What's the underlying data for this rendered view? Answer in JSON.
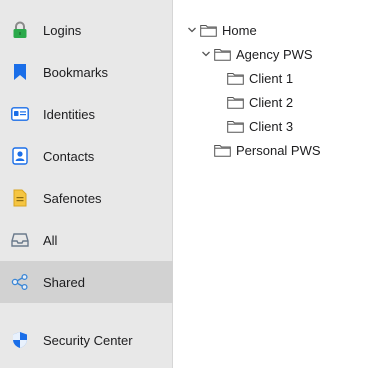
{
  "sidebar": {
    "items": [
      {
        "label": "Logins",
        "icon": "lock-icon",
        "color": "#2aa94a"
      },
      {
        "label": "Bookmarks",
        "icon": "bookmark-icon",
        "color": "#1a6ee8"
      },
      {
        "label": "Identities",
        "icon": "id-card-icon",
        "color": "#1a6ee8"
      },
      {
        "label": "Contacts",
        "icon": "contact-card-icon",
        "color": "#1a6ee8"
      },
      {
        "label": "Safenotes",
        "icon": "note-icon",
        "color": "#f5c542"
      },
      {
        "label": "All",
        "icon": "inbox-icon",
        "color": "#6b7a8c"
      },
      {
        "label": "Shared",
        "icon": "share-icon",
        "color": "#3a86d6",
        "selected": true
      },
      {
        "label": "Security Center",
        "icon": "shield-icon",
        "color": "#1a6ee8"
      }
    ]
  },
  "tree": {
    "nodes": [
      {
        "label": "Home",
        "expanded": true
      },
      {
        "label": "Agency PWS",
        "expanded": true
      },
      {
        "label": "Client 1"
      },
      {
        "label": "Client 2"
      },
      {
        "label": "Client 3"
      },
      {
        "label": "Personal PWS"
      }
    ]
  }
}
